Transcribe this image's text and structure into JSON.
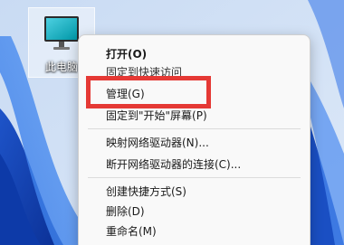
{
  "desktop": {
    "icon_label": "此电脑"
  },
  "context_menu": {
    "items": [
      {
        "label": "打开(O)"
      },
      {
        "label": "固定到快速访问"
      },
      {
        "label": "管理(G)"
      },
      {
        "label": "固定到\"开始\"屏幕(P)"
      },
      {
        "label": "映射网络驱动器(N)..."
      },
      {
        "label": "断开网络驱动器的连接(C)..."
      },
      {
        "label": "创建快捷方式(S)"
      },
      {
        "label": "删除(D)"
      },
      {
        "label": "重命名(M)"
      }
    ]
  },
  "colors": {
    "highlight": "#e53935",
    "menu_bg": "#f9f9f9"
  }
}
